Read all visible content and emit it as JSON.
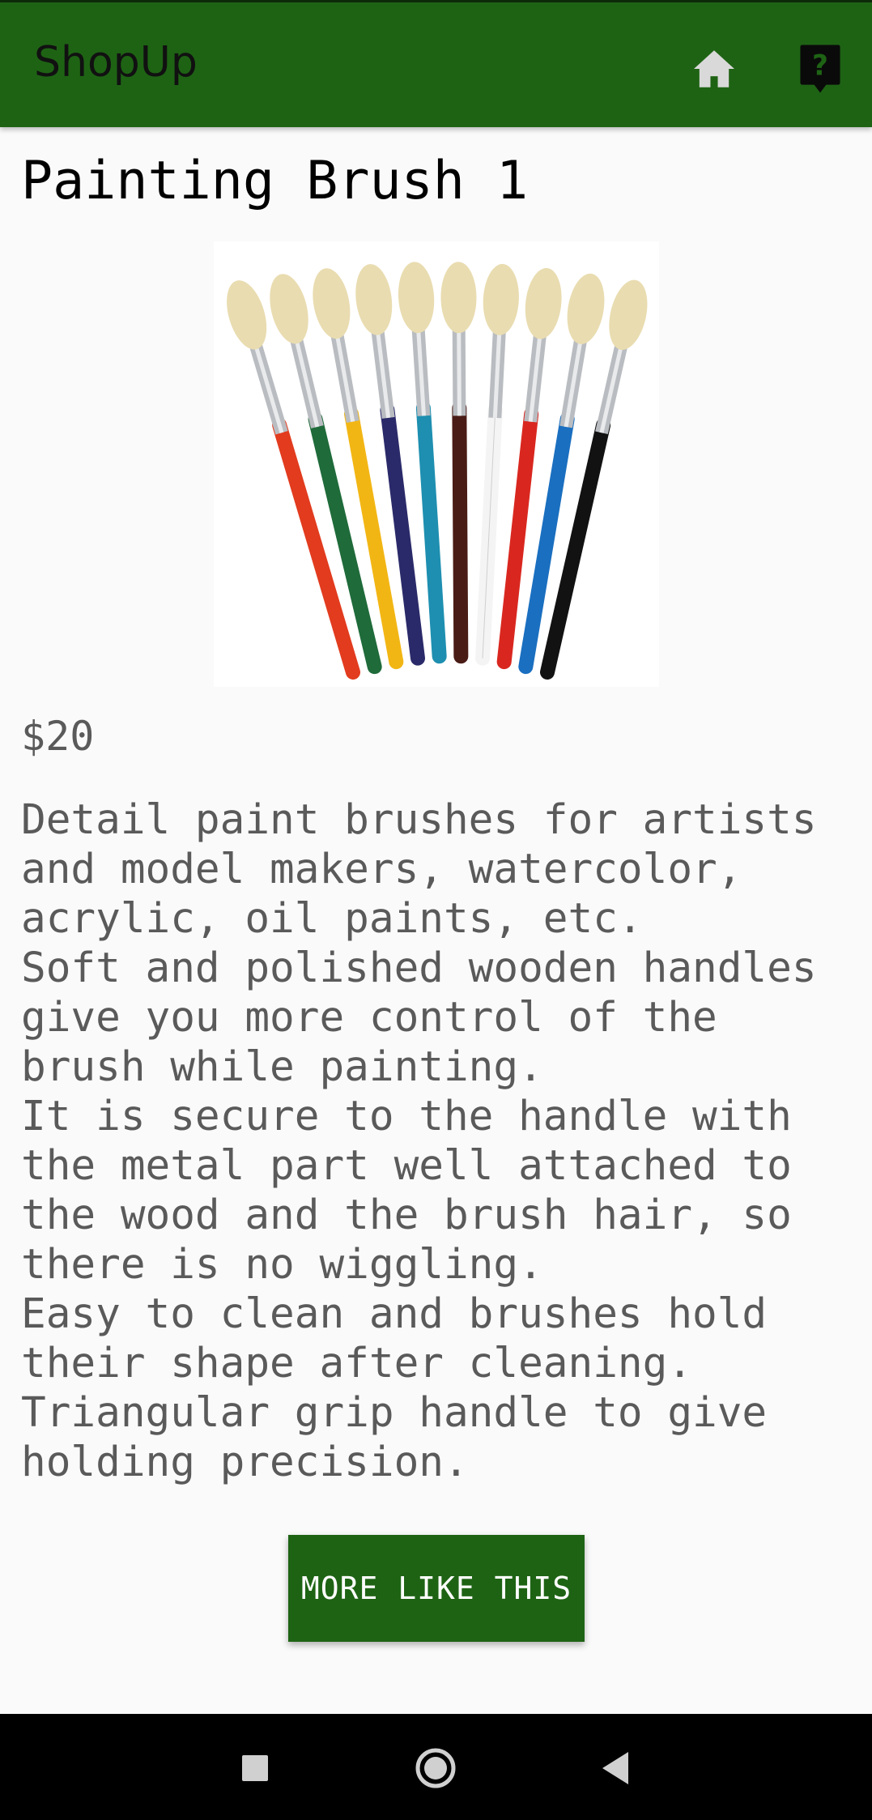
{
  "app": {
    "title": "ShopUp",
    "icons": {
      "home": "home-icon",
      "help": "help-icon"
    },
    "colors": {
      "primary": "#1e6314",
      "background": "#fafafa",
      "text_secondary": "#5a5a5a"
    }
  },
  "product": {
    "title": "Painting Brush 1",
    "image_icon": "paint-brushes-image",
    "price": "$20",
    "description": "Detail paint brushes for artists\nand model makers, watercolor,\nacrylic, oil paints, etc.\nSoft and polished wooden handles\ngive you more control of the\nbrush while painting.\nIt is secure to the handle with\nthe metal part well attached to\nthe wood and the brush hair, so\nthere is no wiggling.\nEasy to clean and brushes hold\ntheir shape after cleaning.\nTriangular grip handle to give\nholding precision.",
    "more_button_label": "MORE LIKE THIS"
  },
  "navbar": {
    "icons": [
      "recents-icon",
      "home-circle-icon",
      "back-icon"
    ]
  }
}
